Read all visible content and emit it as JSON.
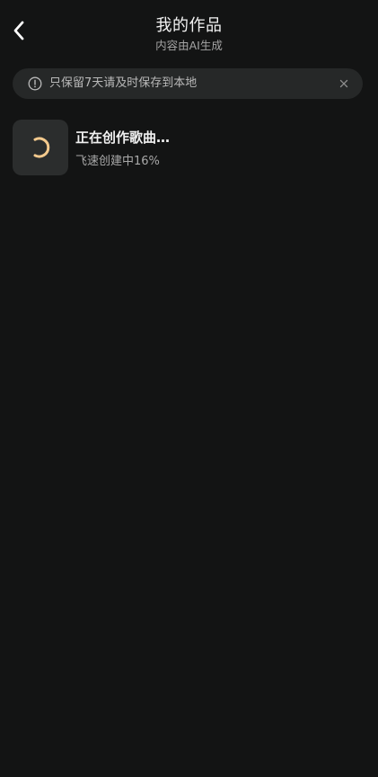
{
  "header": {
    "title": "我的作品",
    "subtitle": "内容由AI生成"
  },
  "notice": {
    "text": "只保留7天请及时保存到本地",
    "icon": "info-circle-icon",
    "close_icon": "close-icon"
  },
  "works": [
    {
      "title": "正在创作歌曲…",
      "status": "飞速创建中16%",
      "progress_percent": 16,
      "icon": "loading-spinner-icon"
    }
  ],
  "colors": {
    "background": "#131414",
    "notice_bg": "#262828",
    "cover_bg": "#2b2d2d",
    "spinner": "#f3c98d",
    "primary_text": "#f0f0f0",
    "secondary_text": "#a9a9a9"
  }
}
